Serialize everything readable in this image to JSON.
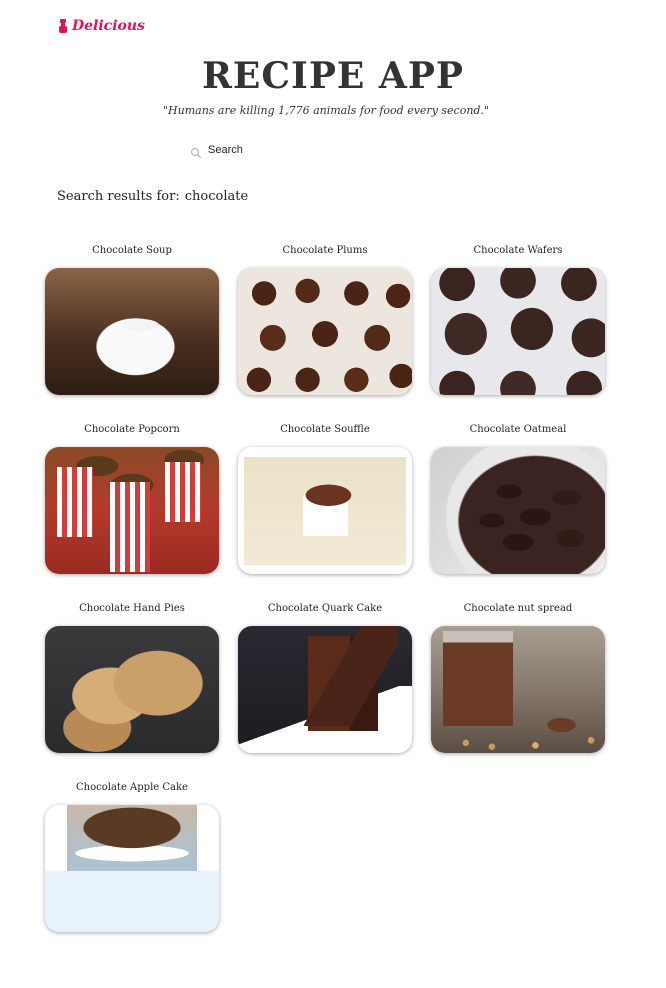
{
  "brand": {
    "name": "Delicious",
    "icon": "chef-icon",
    "color": "#e0115f"
  },
  "header": {
    "title": "RECIPE APP",
    "quote": "\"Humans are killing 1,776 animals for food every second.\""
  },
  "search": {
    "placeholder": "Search",
    "value": "",
    "icon": "search-icon"
  },
  "results": {
    "label": "Search results for:",
    "query": "chocolate"
  },
  "recipes": [
    {
      "title": "Chocolate Soup"
    },
    {
      "title": "Chocolate Plums"
    },
    {
      "title": "Chocolate Wafers"
    },
    {
      "title": "Chocolate Popcorn"
    },
    {
      "title": "Chocolate Souffle"
    },
    {
      "title": "Chocolate Oatmeal"
    },
    {
      "title": "Chocolate Hand Pies"
    },
    {
      "title": "Chocolate Quark Cake"
    },
    {
      "title": "Chocolate nut spread"
    },
    {
      "title": "Chocolate Apple Cake"
    }
  ]
}
